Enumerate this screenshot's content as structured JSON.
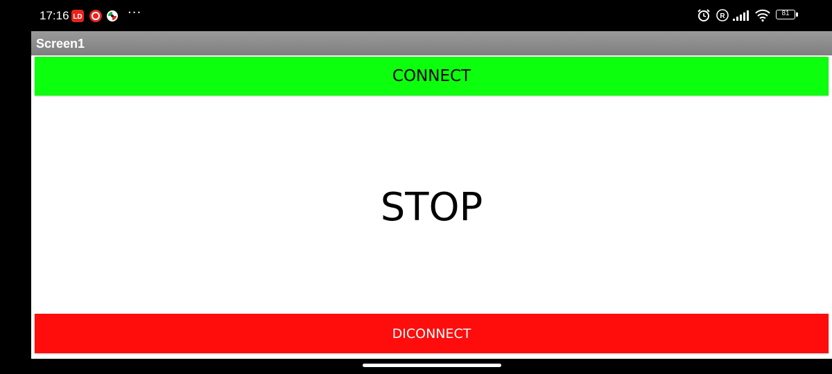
{
  "status_bar": {
    "time": "17:16",
    "battery_level": "81",
    "notification_icons": [
      "ld-player-icon",
      "ld-store-icon",
      "app-notification-icon"
    ],
    "more_label": "···",
    "system_icons": [
      "alarm-icon",
      "registered-icon",
      "signal-icon",
      "wifi-icon",
      "battery-icon"
    ]
  },
  "app": {
    "title": "Screen1",
    "connect_label": "CONNECT",
    "status_text": "STOP",
    "disconnect_label": "DICONNECT"
  },
  "colors": {
    "connect_button": "#0cff0c",
    "disconnect_button": "#ff0c0c",
    "title_bar": "#8a8a8a",
    "background": "#ffffff"
  }
}
